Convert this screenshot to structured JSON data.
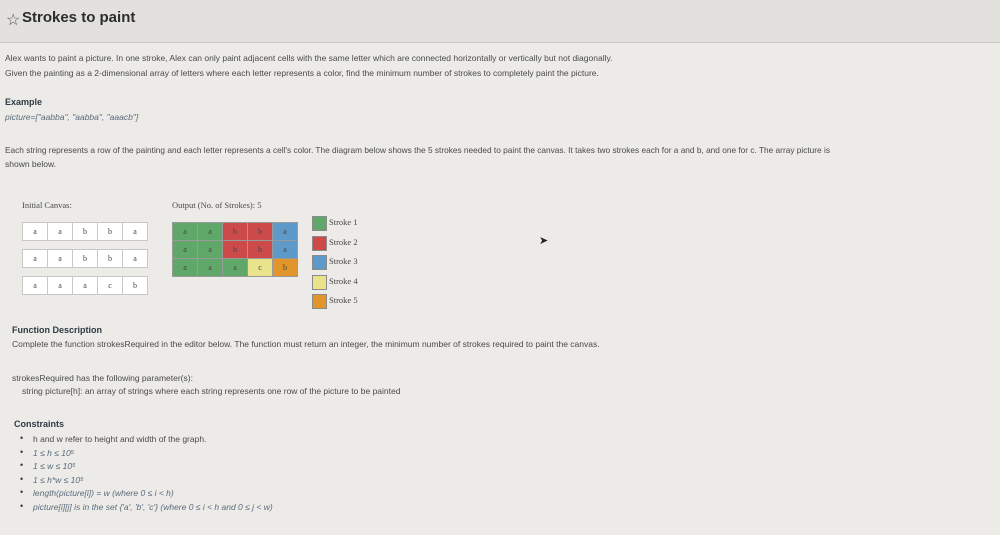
{
  "header": {
    "title": "Strokes to paint"
  },
  "intro": {
    "line1": "Alex wants to paint a picture. In one stroke, Alex can only paint adjacent cells with the same letter which are connected horizontally or vertically but not diagonally.",
    "line2": "Given the painting as a 2-dimensional array of letters where each letter represents a color, find the minimum number of strokes to completely paint the picture."
  },
  "example": {
    "heading": "Example",
    "picture": "picture=[\"aabba\", \"aabba\", \"aaacb\"]",
    "desc1": "Each string represents a row of the painting and each letter represents a cell's color. The diagram below shows the 5 strokes needed to paint the canvas. It takes two strokes each for a and b, and one for c. The array picture is",
    "desc2": "shown below."
  },
  "diagram": {
    "initial_label": "Initial Canvas:",
    "output_label": "Output (No. of Strokes): 5",
    "rows": [
      [
        "a",
        "a",
        "b",
        "b",
        "a"
      ],
      [
        "a",
        "a",
        "b",
        "b",
        "a"
      ],
      [
        "a",
        "a",
        "a",
        "c",
        "b"
      ]
    ],
    "colors": [
      [
        "#5fa86a",
        "#5fa86a",
        "#cc4a4a",
        "#cc4a4a",
        "#5d9ac9"
      ],
      [
        "#5fa86a",
        "#5fa86a",
        "#cc4a4a",
        "#cc4a4a",
        "#5d9ac9"
      ],
      [
        "#5fa86a",
        "#5fa86a",
        "#5fa86a",
        "#e8e38c",
        "#e0962c"
      ]
    ],
    "legend": [
      {
        "label": "Stroke 1",
        "color": "#5fa86a"
      },
      {
        "label": "Stroke 2",
        "color": "#cc4a4a"
      },
      {
        "label": "Stroke 3",
        "color": "#5d9ac9"
      },
      {
        "label": "Stroke 4",
        "color": "#e8e38c"
      },
      {
        "label": "Stroke 5",
        "color": "#e0962c"
      }
    ]
  },
  "function_desc": {
    "heading": "Function Description",
    "text": "Complete the function strokesRequired in the editor below. The function must return an integer, the minimum number of strokes required to paint the canvas.",
    "params_heading": "strokesRequired has the following parameter(s):",
    "param1": "string picture[h]:  an array of strings where each string represents one row of the picture to be painted"
  },
  "constraints": {
    "heading": "Constraints",
    "items": [
      "h and w refer to height and width of the graph.",
      "1 ≤ h ≤ 10⁵",
      "1 ≤ w ≤ 10⁵",
      "1 ≤ h*w ≤ 10⁵",
      "length(picture[i]) = w (where 0 ≤ i < h)",
      "picture[i][j] is in the set {'a', 'b', 'c'} (where 0 ≤ i < h and 0 ≤ j < w)"
    ]
  }
}
